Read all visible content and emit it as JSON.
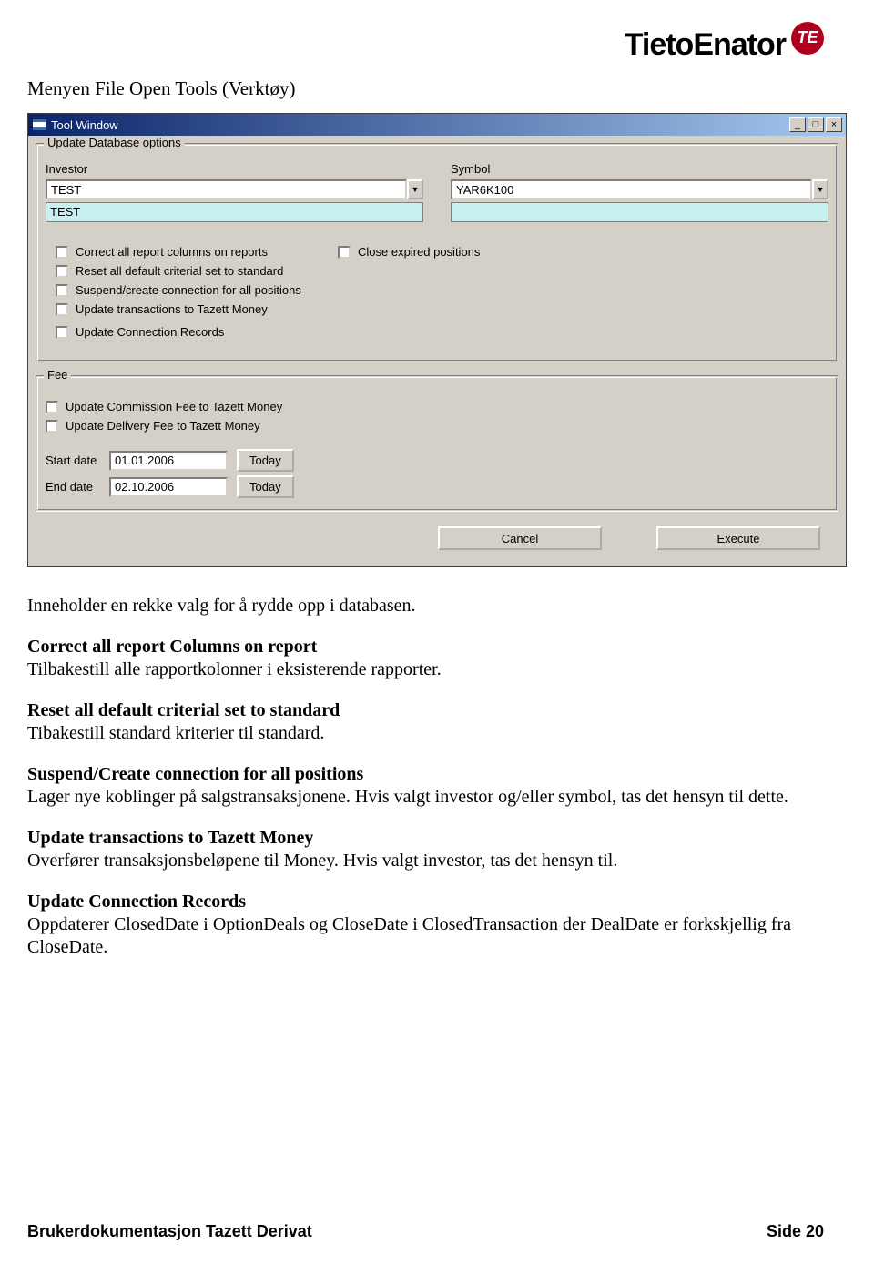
{
  "logo": {
    "brand": "TietoEnator",
    "badge": "TE"
  },
  "heading": "Menyen File Open Tools (Verktøy)",
  "window": {
    "title": "Tool Window",
    "group_main": "Update Database options",
    "investor_label": "Investor",
    "symbol_label": "Symbol",
    "investor_value": "TEST",
    "symbol_value": "YAR6K100",
    "investor_selected": "TEST",
    "symbol_selected": "",
    "checks": {
      "c1": "Correct all report columns on reports",
      "c2": "Reset all default criterial set to standard",
      "c3": "Suspend/create connection for all positions",
      "c4": "Update transactions to Tazett Money",
      "c5": "Update Connection Records",
      "c6": "Close expired positions"
    },
    "group_fee": "Fee",
    "fee_checks": {
      "f1": "Update Commission Fee to Tazett Money",
      "f2": "Update Delivery Fee to Tazett Money"
    },
    "start_label": "Start date",
    "end_label": "End date",
    "start_value": "01.01.2006",
    "end_value": "02.10.2006",
    "today": "Today",
    "cancel": "Cancel",
    "execute": "Execute"
  },
  "body_text": {
    "p1": "Inneholder en rekke valg for å rydde opp i databasen.",
    "h1": "Correct all report Columns on report",
    "p2": "Tilbakestill alle rapportkolonner i eksisterende rapporter.",
    "h2": "Reset all default criterial set to standard",
    "p3": "Tibakestill standard kriterier til standard.",
    "h3": "Suspend/Create connection for all positions",
    "p4": "Lager nye koblinger på salgstransaksjonene. Hvis valgt investor og/eller symbol, tas det hensyn til dette.",
    "h4": "Update transactions to Tazett Money",
    "p5": "Overfører transaksjonsbeløpene til Money. Hvis valgt investor, tas det hensyn til.",
    "h5": "Update Connection Records",
    "p6": "Oppdaterer ClosedDate i OptionDeals og CloseDate i ClosedTransaction  der DealDate er forkskjellig fra CloseDate."
  },
  "footer": {
    "left": "Brukerdokumentasjon Tazett Derivat",
    "right": "Side 20"
  }
}
